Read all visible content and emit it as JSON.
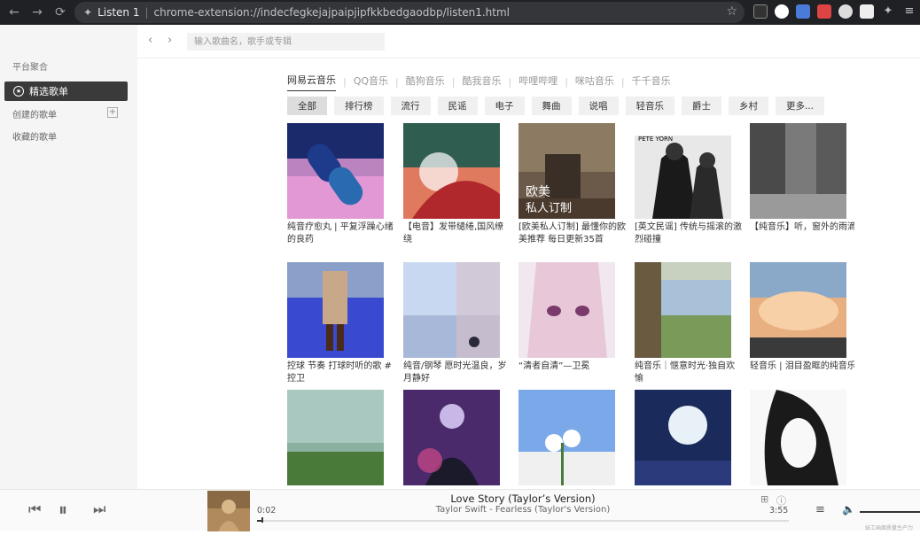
{
  "browser": {
    "tab_title": "Listen 1",
    "url": "chrome-extension://indecfegkejajpaipjipfkkbedgaodbp/listen1.html"
  },
  "sidebar": {
    "section_platform": "平台聚合",
    "active_item": "精选歌单",
    "created": "创建的歌单",
    "favorites": "收藏的歌单"
  },
  "search": {
    "placeholder": "输入歌曲名，歌手或专辑"
  },
  "platforms": [
    "网易云音乐",
    "QQ音乐",
    "酷狗音乐",
    "酷我音乐",
    "哔哩哔哩",
    "咪咕音乐",
    "千千音乐"
  ],
  "filters": [
    "全部",
    "排行榜",
    "流行",
    "民谣",
    "电子",
    "舞曲",
    "说唱",
    "轻音乐",
    "爵士",
    "乡村",
    "更多..."
  ],
  "playlists": [
    {
      "title": "纯音疗愈丸 | 平复浮躁心绪的良药"
    },
    {
      "title": "【电音】发带缱绻,国风缭绕"
    },
    {
      "title": "[欧美私人订制] 最懂你的欧美推荐 每日更新35首",
      "cover_text": "欧美\n私人订制"
    },
    {
      "title": "[英文民谣] 传统与摇滚的激烈碰撞",
      "cover_text": "PETE YORN"
    },
    {
      "title": "【纯音乐】听，窗外的雨滴"
    },
    {
      "title": "控球 节奏 打球时听的歌 # 控卫"
    },
    {
      "title": "纯音/钢琴 愿时光温良，岁月静好"
    },
    {
      "title": "“清者自清”—卫冕"
    },
    {
      "title": "纯音乐｜惬意时光·独自欢愉"
    },
    {
      "title": "轻音乐 | 泪目盈眶的纯音乐"
    },
    {
      "title": ""
    },
    {
      "title": ""
    },
    {
      "title": ""
    },
    {
      "title": ""
    },
    {
      "title": ""
    }
  ],
  "player": {
    "song": "Love Story (Taylor’s Version)",
    "artist": "Taylor Swift - Fearless (Taylor's Version)",
    "current_time": "0:02",
    "total_time": "3:55",
    "progress_fraction": 0.009,
    "volume_fraction": 1.0,
    "watermark": "妹工画面质量生产力"
  }
}
